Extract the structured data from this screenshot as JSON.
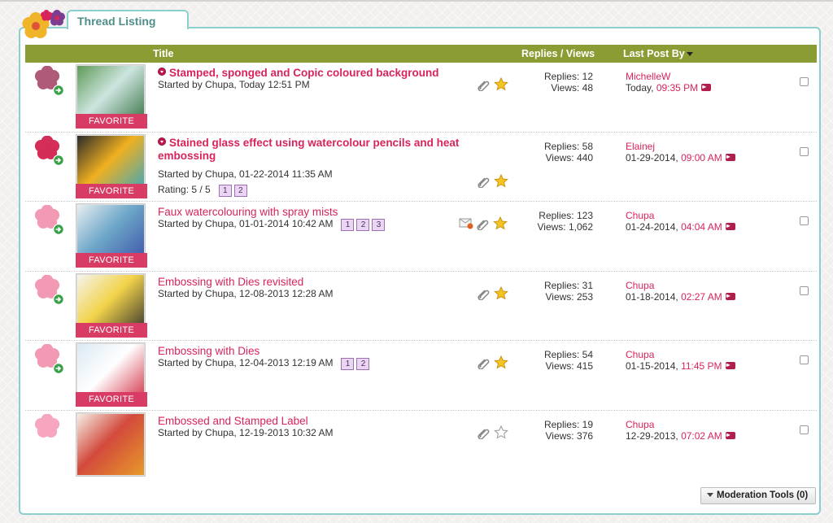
{
  "section": {
    "title": "Thread Listing"
  },
  "columns": {
    "title": "Title",
    "replies_views": "Replies / Views",
    "last_post_by": "Last Post By"
  },
  "favorite_label": "FAVORITE",
  "threads": [
    {
      "title": "Stamped, sponged and Copic coloured background",
      "bold": true,
      "new_dot": true,
      "started": "Started by Chupa, Today 12:51 PM",
      "rating": "",
      "pages": [],
      "replies": "Replies: 12",
      "views": "Views: 48",
      "last_user": "MichelleW",
      "last_date": "Today,",
      "last_time": "09:35 PM",
      "favorite": true,
      "star": "filled",
      "mail": false,
      "status_color": "#b05a7a",
      "thumb_colors": [
        "#5f9a58",
        "#cde5e0",
        "#2f6c3a"
      ]
    },
    {
      "title": "Stained glass effect using watercolour pencils and heat embossing",
      "bold": true,
      "new_dot": true,
      "started": "Started by Chupa, 01-22-2014 11:35 AM",
      "rating": "Rating: 5 / 5",
      "pages": [
        "1",
        "2"
      ],
      "replies": "Replies: 58",
      "views": "Views: 440",
      "last_user": "Elainej",
      "last_date": "01-29-2014,",
      "last_time": "09:00 AM",
      "favorite": true,
      "star": "filled",
      "mail": false,
      "status_color": "#d42d58",
      "thumb_colors": [
        "#2a2a2a",
        "#f0b020",
        "#2da6c9"
      ]
    },
    {
      "title": "Faux watercolouring with spray mists",
      "bold": false,
      "new_dot": false,
      "started": "Started by Chupa, 01-01-2014 10:42 AM",
      "rating": "",
      "pages": [
        "1",
        "2",
        "3"
      ],
      "replies": "Replies: 123",
      "views": "Views: 1,062",
      "last_user": "Chupa",
      "last_date": "01-24-2014,",
      "last_time": "04:04 AM",
      "favorite": true,
      "star": "filled",
      "mail": true,
      "status_color": "#f29ab4",
      "thumb_colors": [
        "#e8eef2",
        "#6ea7c8",
        "#3a4fa8"
      ]
    },
    {
      "title": "Embossing with Dies revisited",
      "bold": false,
      "new_dot": false,
      "started": "Started by Chupa, 12-08-2013 12:28 AM",
      "rating": "",
      "pages": [],
      "replies": "Replies: 31",
      "views": "Views: 253",
      "last_user": "Chupa",
      "last_date": "01-18-2014,",
      "last_time": "02:27 AM",
      "favorite": true,
      "star": "filled",
      "mail": false,
      "status_color": "#f29ab4",
      "thumb_colors": [
        "#f4f4ee",
        "#f3d34a",
        "#2b2b2b"
      ]
    },
    {
      "title": "Embossing with Dies",
      "bold": false,
      "new_dot": false,
      "started": "Started by Chupa, 12-04-2013 12:19 AM",
      "rating": "",
      "pages": [
        "1",
        "2"
      ],
      "replies": "Replies: 54",
      "views": "Views: 415",
      "last_user": "Chupa",
      "last_date": "01-15-2014,",
      "last_time": "11:45 PM",
      "favorite": true,
      "star": "filled",
      "mail": false,
      "status_color": "#f29ab4",
      "thumb_colors": [
        "#dbe9f2",
        "#ffffff",
        "#d0243a"
      ]
    },
    {
      "title": "Embossed and Stamped Label",
      "bold": false,
      "new_dot": false,
      "started": "Started by Chupa, 12-19-2013 10:32 AM",
      "rating": "",
      "pages": [],
      "replies": "Replies: 19",
      "views": "Views: 376",
      "last_user": "Chupa",
      "last_date": "12-29-2013,",
      "last_time": "07:02 AM",
      "favorite": false,
      "star": "empty",
      "mail": false,
      "status_color": "#f7a6c0",
      "thumb_colors": [
        "#f6efe6",
        "#d24a3c",
        "#e89a2a"
      ]
    }
  ],
  "moderation": {
    "label": "Moderation Tools (0)"
  },
  "colors": {
    "accent": "#d8245a",
    "header": "#8c9c35",
    "teal": "#8bcfcf"
  }
}
